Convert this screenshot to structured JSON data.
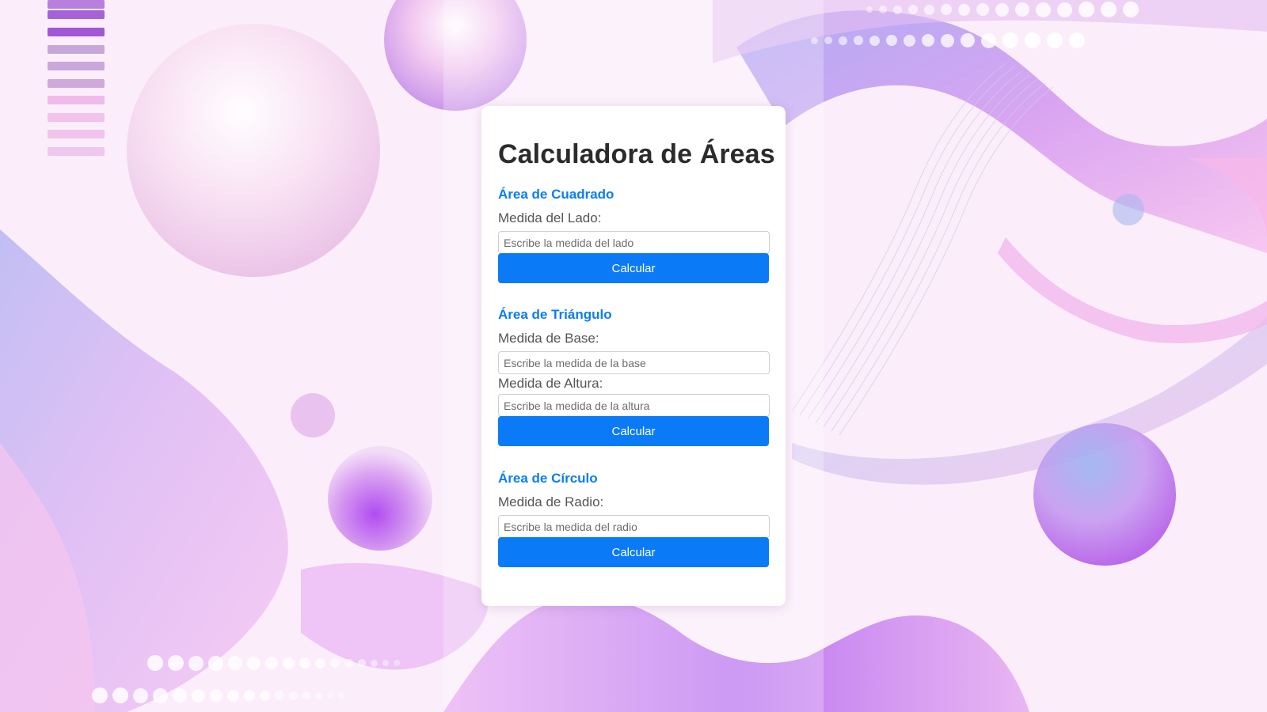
{
  "page": {
    "title": "Calculadora de Áreas"
  },
  "sections": {
    "square": {
      "title": "Área de Cuadrado",
      "side_label": "Medida del Lado:",
      "side_placeholder": "Escribe la medida del lado",
      "button_label": "Calcular"
    },
    "triangle": {
      "title": "Área de Triángulo",
      "base_label": "Medida de Base:",
      "base_placeholder": "Escribe la medida de la base",
      "height_label": "Medida de Altura:",
      "height_placeholder": "Escribe la medida de la altura",
      "button_label": "Calcular"
    },
    "circle": {
      "title": "Área de Círculo",
      "radius_label": "Medida de Radio:",
      "radius_placeholder": "Escribe la medida del radio",
      "button_label": "Calcular"
    }
  },
  "colors": {
    "accent": "#0a7af7",
    "section_title": "#0a7df5",
    "heading": "#2b2b2b",
    "label": "#555555",
    "background": "#fbeefa"
  }
}
